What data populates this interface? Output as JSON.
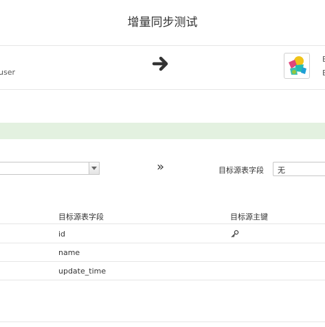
{
  "header": {
    "title": "增量同步测试"
  },
  "source": {
    "label": "user"
  },
  "target": {
    "letters": [
      "E",
      "E"
    ]
  },
  "mapping": {
    "source_select_value": "",
    "target_field_label": "目标源表字段",
    "target_field_value": "无"
  },
  "table": {
    "headers": [
      "目标源表字段",
      "目标源主键"
    ],
    "rows": [
      {
        "field": "id",
        "is_key": true
      },
      {
        "field": "name",
        "is_key": false
      },
      {
        "field": "update_time",
        "is_key": false
      }
    ]
  },
  "icons": {
    "arrow": "arrow-right-icon",
    "logo": "elasticsearch-logo-icon",
    "dropdown": "dropdown-arrow-icon",
    "double_chevron": "double-chevron-right-icon",
    "key": "key-icon"
  },
  "colors": {
    "green_bar": "#e3f1e0",
    "divider": "#e6e6e6"
  }
}
